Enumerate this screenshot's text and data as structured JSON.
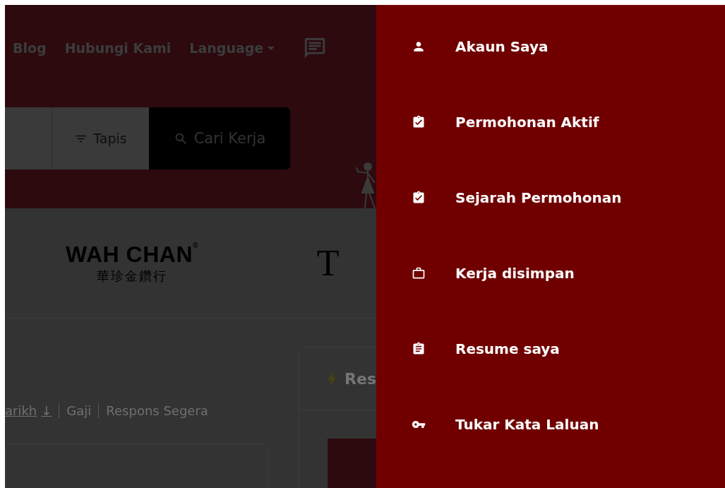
{
  "header": {
    "nav_links": [
      "Blog",
      "Hubungi Kami"
    ],
    "language": "Language",
    "filter_label": "Tapis",
    "search_button": "Cari Kerja"
  },
  "brands": {
    "primary_name": "WAH CHAN",
    "primary_mark": "®",
    "primary_chinese": "華珍金鑽行",
    "secondary_letter": "T"
  },
  "sort_options": [
    {
      "label": "arikh",
      "arrow": "↓",
      "selected": true
    },
    {
      "label": "Gaji",
      "selected": false
    },
    {
      "label": "Respons Segera",
      "selected": false
    }
  ],
  "side_card": {
    "title": "Res"
  },
  "drawer": {
    "items": [
      {
        "label": "Akaun Saya",
        "kind": "person"
      },
      {
        "label": "Permohonan Aktif",
        "kind": "clipboard-check"
      },
      {
        "label": "Sejarah Permohonan",
        "kind": "clipboard-check"
      },
      {
        "label": "Kerja disimpan",
        "kind": "briefcase"
      },
      {
        "label": "Resume saya",
        "kind": "clipboard"
      },
      {
        "label": "Tukar Kata Laluan",
        "kind": "key"
      }
    ]
  }
}
